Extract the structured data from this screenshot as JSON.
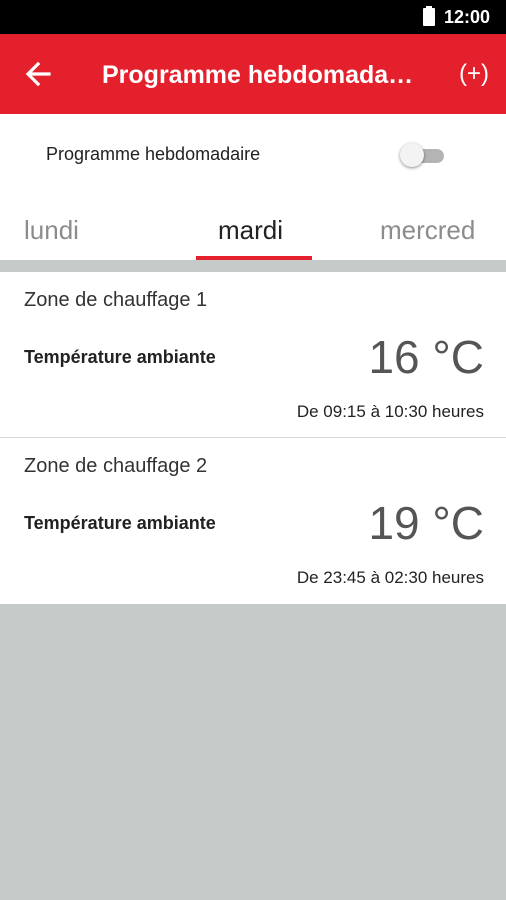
{
  "status_bar": {
    "time": "12:00",
    "battery_icon": "battery-full-icon"
  },
  "app_bar": {
    "title": "Programme hebdomada…",
    "back_icon": "arrow-back-icon",
    "add_label": "(+)",
    "background_color": "#e3202c"
  },
  "weekly_toggle": {
    "label": "Programme hebdomadaire",
    "enabled": false
  },
  "tabs": [
    {
      "label": "lundi",
      "active": false
    },
    {
      "label": "mardi",
      "active": true
    },
    {
      "label": "mercred",
      "active": false
    }
  ],
  "zones": [
    {
      "name": "Zone de chauffage 1",
      "temperature_label": "Température ambiante",
      "temperature": "16 °C",
      "schedule": "De 09:15 à 10:30 heures"
    },
    {
      "name": "Zone de chauffage 2",
      "temperature_label": "Température ambiante",
      "temperature": "19 °C",
      "schedule": "De 23:45 à 02:30 heures"
    }
  ],
  "colors": {
    "accent": "#e3202c",
    "background": "#c6cbc9"
  }
}
